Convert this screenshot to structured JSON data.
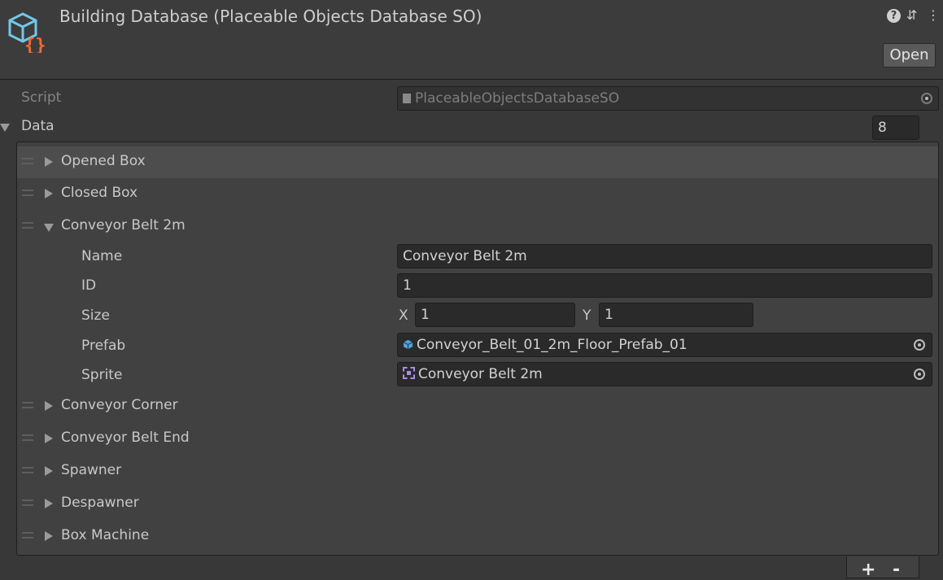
{
  "header": {
    "title": "Building Database (Placeable Objects Database SO)",
    "open_label": "Open",
    "help_glyph": "?",
    "preset_glyph": "⇵",
    "menu_glyph": "⋮"
  },
  "script": {
    "label": "Script",
    "value": "PlaceableObjectsDatabaseSO"
  },
  "data": {
    "label": "Data",
    "count": "8",
    "items": [
      {
        "label": "Opened Box"
      },
      {
        "label": "Closed Box"
      },
      {
        "label": "Conveyor Belt 2m"
      },
      {
        "label": "Conveyor Corner"
      },
      {
        "label": "Conveyor Belt End"
      },
      {
        "label": "Spawner"
      },
      {
        "label": "Despawner"
      },
      {
        "label": "Box Machine"
      }
    ],
    "expanded": {
      "name_label": "Name",
      "name_value": "Conveyor Belt 2m",
      "id_label": "ID",
      "id_value": "1",
      "size_label": "Size",
      "size_x_label": "X",
      "size_x_value": "1",
      "size_y_label": "Y",
      "size_y_value": "1",
      "prefab_label": "Prefab",
      "prefab_value": "Conveyor_Belt_01_2m_Floor_Prefab_01",
      "sprite_label": "Sprite",
      "sprite_value": "Conveyor Belt 2m"
    }
  },
  "footer": {
    "add_label": "+",
    "remove_label": "-"
  },
  "colors": {
    "background": "#383838",
    "field": "#2a2a2a",
    "icon_orange": "#ef6a35",
    "icon_cyan": "#72c7e8",
    "prefab_blue": "#4aa3df",
    "sprite_purple": "#a98ee8"
  },
  "icons": [
    "scriptable-object-icon",
    "help-icon",
    "preset-icon",
    "menu-icon",
    "script-file-icon",
    "object-picker-icon",
    "prefab-cube-icon",
    "sprite-icon",
    "drag-handle-icon",
    "foldout-icon"
  ]
}
